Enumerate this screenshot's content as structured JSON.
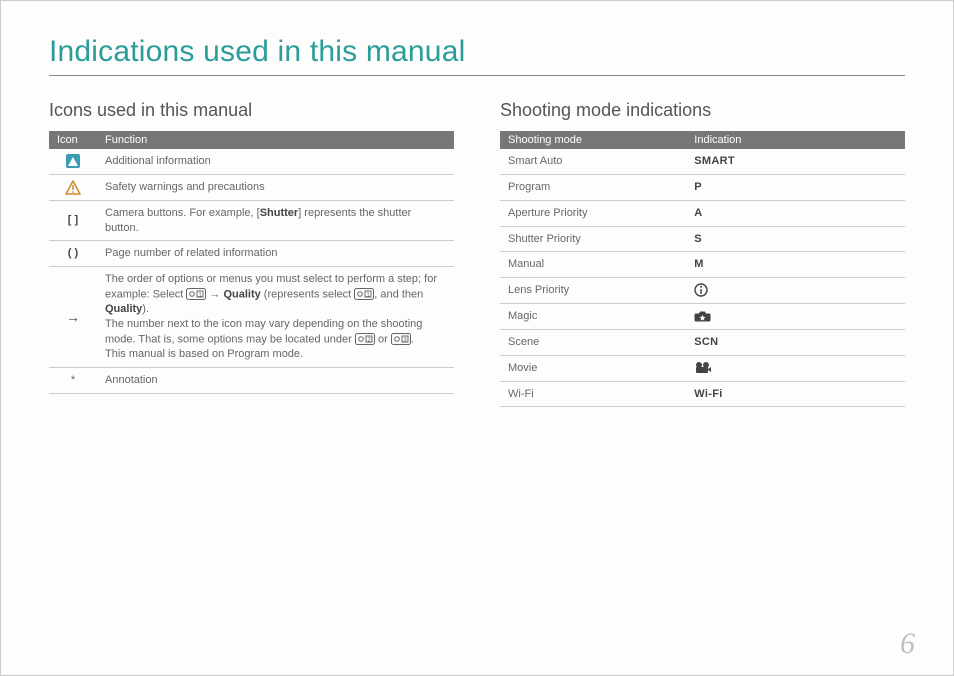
{
  "page": {
    "title": "Indications used in this manual",
    "number": "6"
  },
  "left": {
    "heading": "Icons used in this manual",
    "th_icon": "Icon",
    "th_func": "Function",
    "rows": {
      "r0_icon": "[  ]",
      "r1_icon": "(  )",
      "r2_icon": "→",
      "r3_icon": "*",
      "f0": "Additional information",
      "f1": "Safety warnings and precautions",
      "f2a": "Camera buttons. For example, [",
      "f2b": "Shutter",
      "f2c": "] represents the shutter button.",
      "f3": "Page number of related information",
      "f4_l1a": "The order of options or menus you must select to perform a step; for example: Select ",
      "f4_l1b": " → ",
      "f4_l1c": "Quality",
      "f4_l1d": " (represents select ",
      "f4_l1e": ", and then ",
      "f4_l1f": "Quality",
      "f4_l1g": ").",
      "f4_l2a": "The number next to the icon may vary depending on the shooting mode. That is, some options may be located under ",
      "f4_l2b": " or ",
      "f4_l2c": ".",
      "f4_l3": "This manual is based on Program mode.",
      "f5": "Annotation"
    }
  },
  "right": {
    "heading": "Shooting mode indications",
    "th_mode": "Shooting mode",
    "th_ind": "Indication",
    "rows": [
      {
        "mode": "Smart Auto",
        "ind": "SMART",
        "type": "text"
      },
      {
        "mode": "Program",
        "ind": "P",
        "type": "text"
      },
      {
        "mode": "Aperture Priority",
        "ind": "A",
        "type": "text"
      },
      {
        "mode": "Shutter Priority",
        "ind": "S",
        "type": "text"
      },
      {
        "mode": "Manual",
        "ind": "M",
        "type": "text"
      },
      {
        "mode": "Lens Priority",
        "ind": "",
        "type": "icon-i"
      },
      {
        "mode": "Magic",
        "ind": "",
        "type": "icon-star"
      },
      {
        "mode": "Scene",
        "ind": "SCN",
        "type": "text"
      },
      {
        "mode": "Movie",
        "ind": "",
        "type": "icon-movie"
      },
      {
        "mode": "Wi-Fi",
        "ind": "Wi-Fi",
        "type": "text"
      }
    ]
  }
}
